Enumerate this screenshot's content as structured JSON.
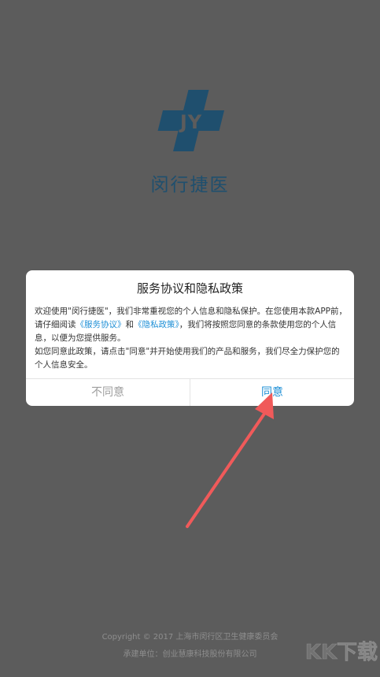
{
  "app": {
    "name": "闵行捷医",
    "brand_color": "#1f4f6e",
    "logo_letters": "JY"
  },
  "dialog": {
    "title": "服务协议和隐私政策",
    "paragraph1": {
      "part1": "欢迎使用\"闵行捷医\"，我们非常重视您的个人信息和隐私保护。在您使用本款APP前，请仔细阅读",
      "link_terms": "《服务协议》",
      "and": "和",
      "link_privacy": "《隐私政策》",
      "part2": "，我们将按照您同意的条款使用您的个人信息，以便为您提供服务。"
    },
    "paragraph2": "如您同意此政策，请点击\"同意\"并开始使用我们的产品和服务，我们尽全力保护您的个人信息安全。",
    "disagree_label": "不同意",
    "agree_label": "同意",
    "link_color": "#1d8fd6"
  },
  "annotation": {
    "arrow_color": "#f05a5a"
  },
  "footer": {
    "copyright": "Copyright © 2017 上海市闵行区卫生健康委员会",
    "undertaker": "承建单位：创业慧康科技股份有限公司"
  },
  "watermark": {
    "text": "KK下载"
  },
  "icons": {
    "logo": "cross-jy-logo-icon",
    "arrow": "red-arrow-icon"
  }
}
